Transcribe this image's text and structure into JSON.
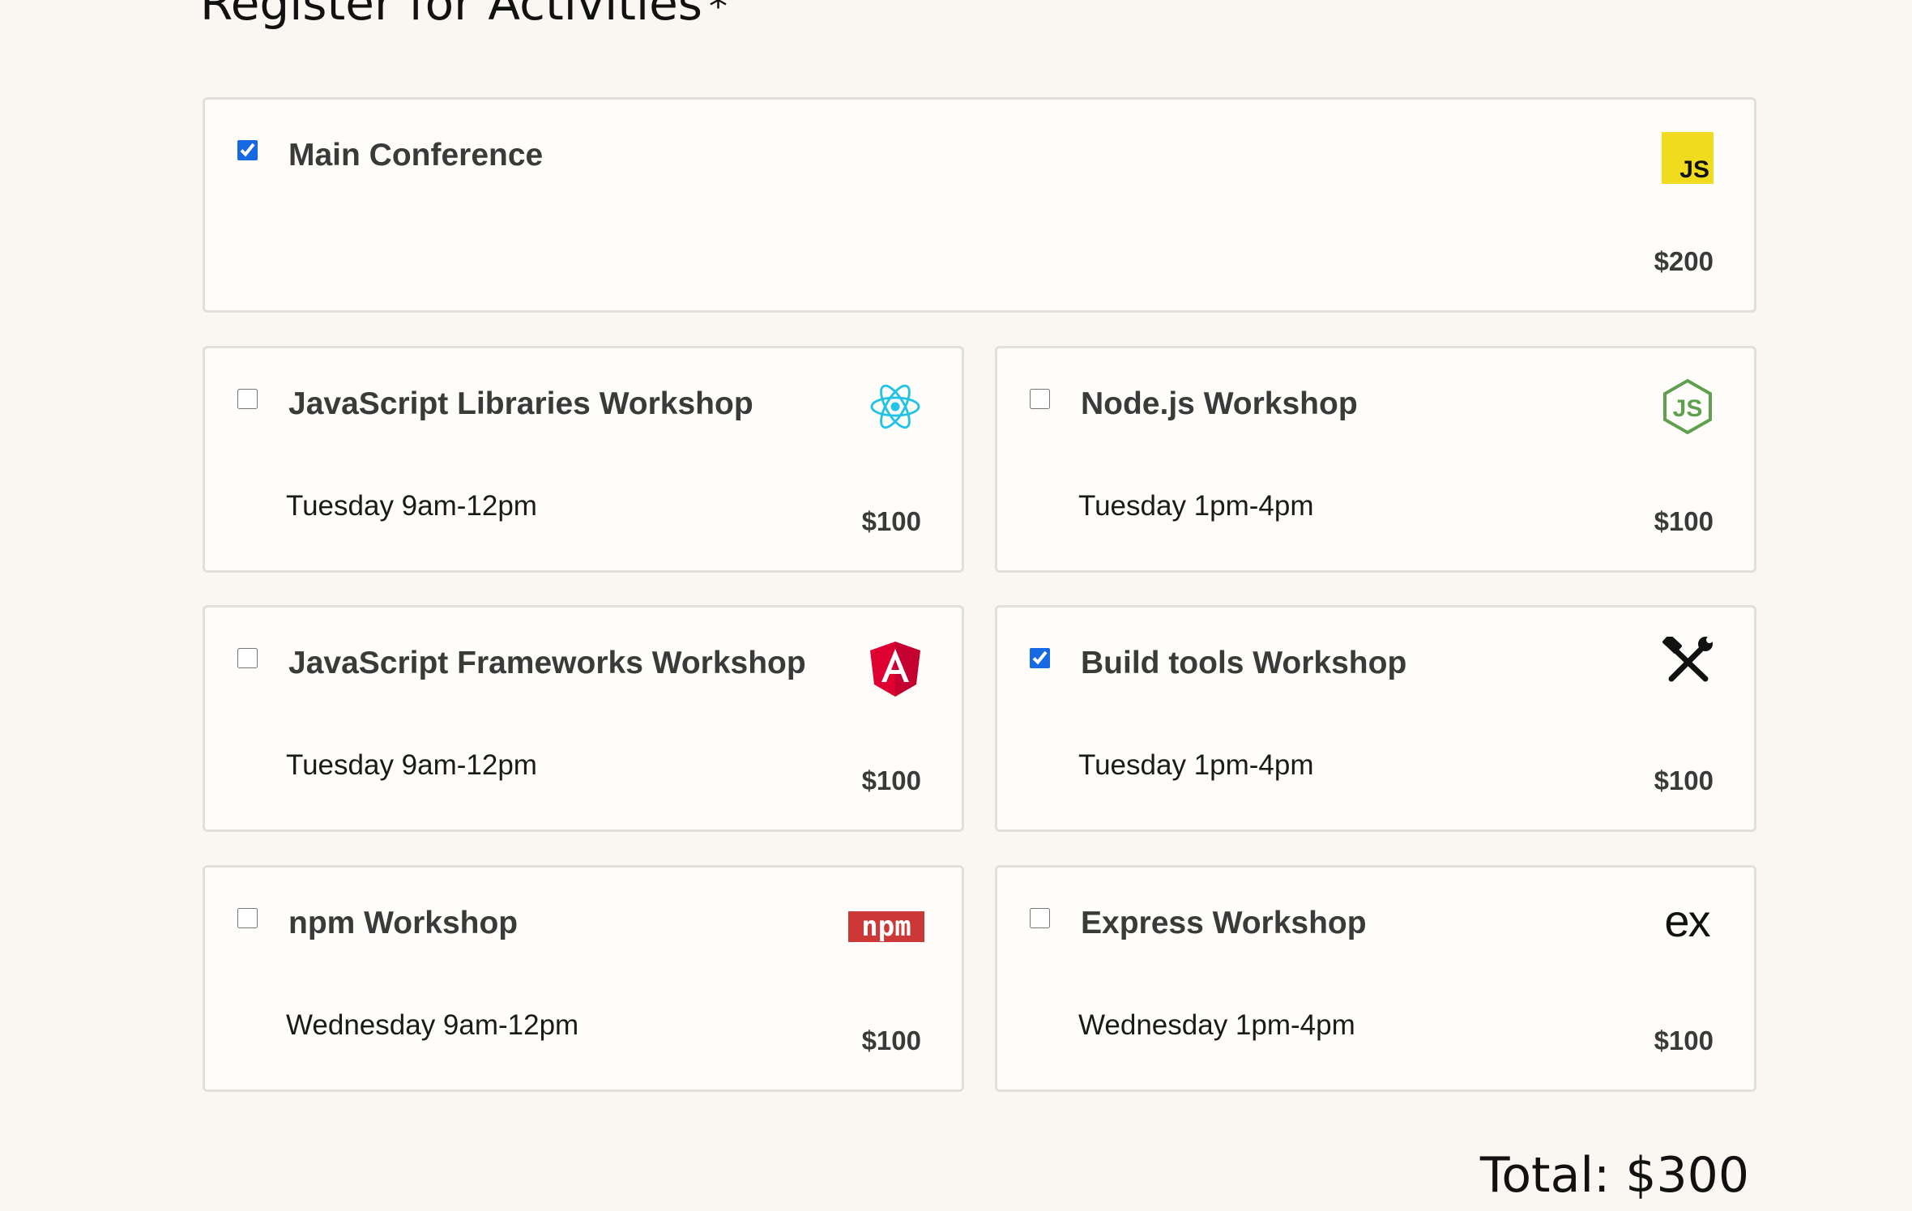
{
  "section": {
    "title": "Register for Activities",
    "required_marker": "*"
  },
  "activities": [
    {
      "name": "Main Conference",
      "time": "",
      "price": "$200",
      "checked": true,
      "icon": "javascript-icon",
      "icon_text": "JS"
    },
    {
      "name": "JavaScript Libraries Workshop",
      "time": "Tuesday 9am-12pm",
      "price": "$100",
      "checked": false,
      "icon": "react-icon"
    },
    {
      "name": "Node.js Workshop",
      "time": "Tuesday 1pm-4pm",
      "price": "$100",
      "checked": false,
      "icon": "nodejs-icon"
    },
    {
      "name": "JavaScript Frameworks Workshop",
      "time": "Tuesday 9am-12pm",
      "price": "$100",
      "checked": false,
      "icon": "angular-icon"
    },
    {
      "name": "Build tools Workshop",
      "time": "Tuesday 1pm-4pm",
      "price": "$100",
      "checked": true,
      "icon": "build-tools-icon"
    },
    {
      "name": "npm Workshop",
      "time": "Wednesday 9am-12pm",
      "price": "$100",
      "checked": false,
      "icon": "npm-icon",
      "icon_text": "npm"
    },
    {
      "name": "Express Workshop",
      "time": "Wednesday 1pm-4pm",
      "price": "$100",
      "checked": false,
      "icon": "express-icon",
      "icon_text": "ex"
    }
  ],
  "total": {
    "label": "Total: $300"
  },
  "colors": {
    "background": "#faf6f1",
    "card": "#fffdfa",
    "card_border": "#e3ded9",
    "checkbox_accent": "#1668e3",
    "js_yellow": "#f0db1f",
    "react_cyan": "#22c3e6",
    "node_green": "#5fa04e",
    "angular_red": "#dd0031",
    "npm_red": "#cb3837"
  }
}
